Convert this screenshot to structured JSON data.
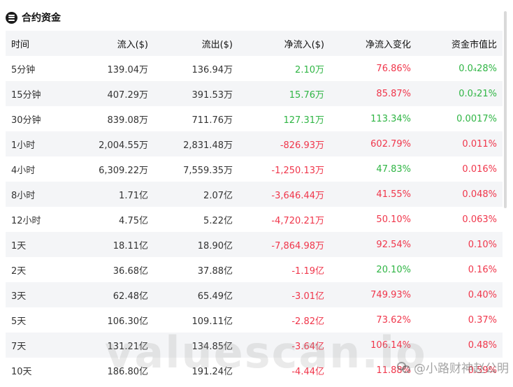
{
  "header": {
    "title": "合约资金",
    "icon": "solana-icon"
  },
  "table": {
    "columns": [
      "时间",
      "流入($)",
      "流出($)",
      "净流入($)",
      "净流入变化",
      "资金市值比"
    ],
    "rows": [
      {
        "time": "5分钟",
        "inflow": "139.04万",
        "outflow": "136.94万",
        "net": "2.10万",
        "net_color": "green",
        "change": "76.86%",
        "change_color": "red",
        "ratio": "0.0₄28%",
        "ratio_color": "green"
      },
      {
        "time": "15分钟",
        "inflow": "407.29万",
        "outflow": "391.53万",
        "net": "15.76万",
        "net_color": "green",
        "change": "85.87%",
        "change_color": "red",
        "ratio": "0.0₃21%",
        "ratio_color": "green"
      },
      {
        "time": "30分钟",
        "inflow": "839.08万",
        "outflow": "711.76万",
        "net": "127.31万",
        "net_color": "green",
        "change": "113.34%",
        "change_color": "green",
        "ratio": "0.0017%",
        "ratio_color": "green"
      },
      {
        "time": "1小时",
        "inflow": "2,004.55万",
        "outflow": "2,831.48万",
        "net": "-826.93万",
        "net_color": "red",
        "change": "602.79%",
        "change_color": "red",
        "ratio": "0.011%",
        "ratio_color": "red"
      },
      {
        "time": "4小时",
        "inflow": "6,309.22万",
        "outflow": "7,559.35万",
        "net": "-1,250.13万",
        "net_color": "red",
        "change": "47.83%",
        "change_color": "green",
        "ratio": "0.016%",
        "ratio_color": "red"
      },
      {
        "time": "8小时",
        "inflow": "1.71亿",
        "outflow": "2.07亿",
        "net": "-3,646.44万",
        "net_color": "red",
        "change": "41.55%",
        "change_color": "red",
        "ratio": "0.048%",
        "ratio_color": "red"
      },
      {
        "time": "12小时",
        "inflow": "4.75亿",
        "outflow": "5.22亿",
        "net": "-4,720.21万",
        "net_color": "red",
        "change": "50.10%",
        "change_color": "red",
        "ratio": "0.063%",
        "ratio_color": "red"
      },
      {
        "time": "1天",
        "inflow": "18.11亿",
        "outflow": "18.90亿",
        "net": "-7,864.98万",
        "net_color": "red",
        "change": "92.54%",
        "change_color": "red",
        "ratio": "0.10%",
        "ratio_color": "red"
      },
      {
        "time": "2天",
        "inflow": "36.68亿",
        "outflow": "37.88亿",
        "net": "-1.19亿",
        "net_color": "red",
        "change": "20.10%",
        "change_color": "green",
        "ratio": "0.16%",
        "ratio_color": "red"
      },
      {
        "time": "3天",
        "inflow": "62.48亿",
        "outflow": "65.49亿",
        "net": "-3.01亿",
        "net_color": "red",
        "change": "749.93%",
        "change_color": "red",
        "ratio": "0.40%",
        "ratio_color": "red"
      },
      {
        "time": "5天",
        "inflow": "106.30亿",
        "outflow": "109.11亿",
        "net": "-2.82亿",
        "net_color": "red",
        "change": "73.62%",
        "change_color": "red",
        "ratio": "0.37%",
        "ratio_color": "red"
      },
      {
        "time": "7天",
        "inflow": "131.21亿",
        "outflow": "134.85亿",
        "net": "-3.64亿",
        "net_color": "red",
        "change": "106.14%",
        "change_color": "red",
        "ratio": "0.48%",
        "ratio_color": "red"
      },
      {
        "time": "10天",
        "inflow": "186.80亿",
        "outflow": "191.24亿",
        "net": "-4.44亿",
        "net_color": "red",
        "change": "11.88%",
        "change_color": "red",
        "ratio": "0.59%",
        "ratio_color": "red"
      }
    ]
  },
  "watermark": "valuescan.io",
  "source_tag": "@小路财神赵公明",
  "colors": {
    "green": "#2fb544",
    "red": "#f0364b",
    "stripe": "#f4f5f7"
  }
}
